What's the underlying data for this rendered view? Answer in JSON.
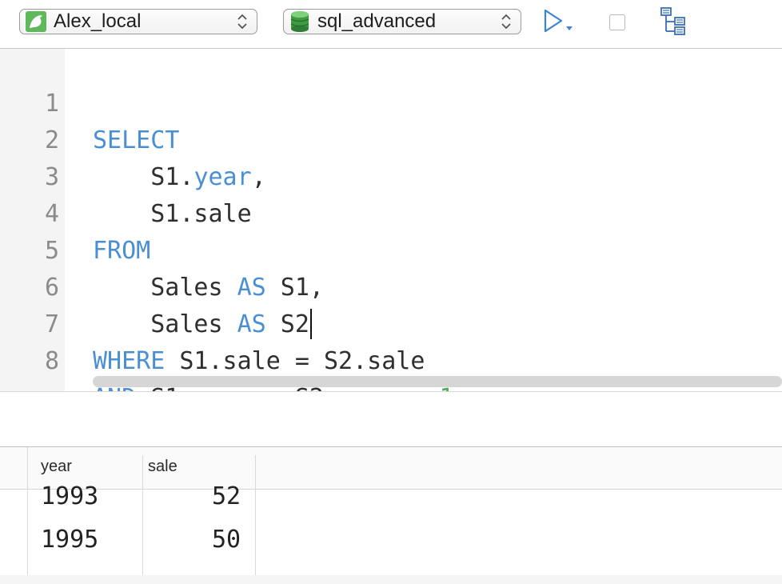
{
  "toolbar": {
    "connection": {
      "label": "Alex_local",
      "icon": "dolphin-icon"
    },
    "database": {
      "label": "sql_advanced",
      "icon": "database-icon"
    },
    "run_icon": "play-icon",
    "stop_icon": "stop-icon",
    "explain_icon": "explain-plan-icon"
  },
  "editor": {
    "line_numbers": [
      "1",
      "2",
      "3",
      "4",
      "5",
      "6",
      "7",
      "8"
    ]
  },
  "results": {
    "columns": [
      "year",
      "sale"
    ],
    "rows": [
      [
        "1993",
        "52"
      ],
      [
        "1995",
        "50"
      ]
    ]
  },
  "colors": {
    "keyword": "#4a8fd4",
    "number": "#4fae5c",
    "text": "#2f2f2f"
  }
}
